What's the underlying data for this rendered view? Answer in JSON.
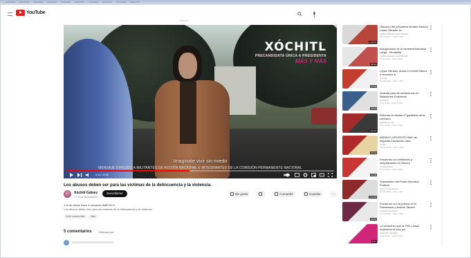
{
  "app": {
    "logo_text": "YouTube",
    "search_placeholder": "Buscar"
  },
  "video": {
    "brand_name": "XÓCHITL",
    "brand_sub": "PRECANDIDATA ÚNICA A PRESIDENTA",
    "brand_slogan": "MÁS Y MÁS",
    "caption": "Imagínate vivir sin miedo",
    "disclaimer": "MENSAJE DIRIGIDO A MILITANTES DE ACCIÓN NACIONAL E INTEGRANTES DE LA COMISIÓN PERMANENTE NACIONAL",
    "timecode": "0:12 / 0:30",
    "progress": 0.46
  },
  "title": "Los abusos deben ser para las víctimas de la delincuencia y la violencia.",
  "channel": {
    "name": "Xóchitl Gálvez",
    "subs": "1.1 M de suscriptores",
    "subscribe_label": "Suscribirme"
  },
  "actions": [
    {
      "label": "Me gusta"
    },
    {
      "label": ""
    },
    {
      "label": "Compartir"
    },
    {
      "label": "Guardar"
    },
    {
      "label": "···"
    }
  ],
  "description": {
    "meta": "1 M de vistas  Hace 4 semanas  #MÉXICO",
    "text": "Los abusos deben ser para las víctimas de la delincuencia y la violencia.",
    "tags": [
      "Ya te convenciste",
      "Más"
    ]
  },
  "comments": {
    "count": "5 comentarios",
    "sort": "Ordenar por"
  },
  "recommendations": [
    {
      "title": "Discurso del presidente Andrés Manuel López Obrador en",
      "channel": "Andrés Manuel López Obrador",
      "meta": "12 mil vistas · hace 2 días",
      "dur": "1:02:14",
      "colors": [
        "#d9d9d9",
        "#b7453a"
      ]
    },
    {
      "title": "Inauguración de la carretera Barranca Larga - Ventanilla",
      "channel": "Andrés Manuel López Obrador",
      "meta": "8 mil vistas · hace 3 días",
      "dur": "58:10",
      "colors": [
        "#e6e6e6",
        "#c0504d"
      ]
    },
    {
      "title": "López Obrador acusa a Xóchitl Gálvez y reconoce a",
      "channel": "Noticias",
      "meta": "20 mil vistas · hace 1 día",
      "dur": "12:34",
      "colors": [
        "#c23d2e",
        "#f0f0f0"
      ]
    },
    {
      "title": "Guardia para de conferencia en Relaciones Exteriores",
      "channel": "Noticieros",
      "meta": "5 mil vistas · hace 6 días",
      "dur": "45:02",
      "colors": [
        "#3b5f8a",
        "#e0e0e0"
      ]
    },
    {
      "title": "Refrenta al oficiale 4º garantiza de la comisión",
      "channel": "Noticias en vivo",
      "meta": "3 mil vistas · hace 4 días",
      "dur": "1:20:05",
      "colors": [
        "#a12a2a",
        "#3a3a3a"
      ]
    },
    {
      "title": "#BRAVO ¡URGENTE! Mitin de segunda inscripción para",
      "channel": "Canal",
      "meta": "15 mil vistas · hace 2 días",
      "dur": "33:40",
      "colors": [
        "#b02a2a",
        "#e8d3a1"
      ]
    },
    {
      "title": "Encuentro con militantes y simpatizantes en México",
      "channel": "Xóchitl Gálvez",
      "meta": "9 mil vistas · hace 5 días",
      "dur": "22:18",
      "colors": [
        "#c93535",
        "#f4f4f4"
      ]
    },
    {
      "title": "Transmisión del Poder Ejecutivo Federal",
      "channel": "Gobierno de México",
      "meta": "30 mil vistas · hace 1 día",
      "dur": "2:10:00",
      "colors": [
        "#8f2a2a",
        "#dddddd"
      ]
    },
    {
      "title": "Encuentro con la prensa en el Sheinbaum y Andrés Tabanil",
      "channel": "Claudia Sheinbaum",
      "meta": "11 mil vistas · hace 3 días",
      "dur": "18:55",
      "colors": [
        "#6e2a45",
        "#e9e9e9"
      ]
    },
    {
      "title": "La verdad es que la TVN ¿Hace realmente el voto por",
      "channel": "XÓCHITL GÁLVEZ",
      "meta": "6 mil vistas · hace 6 días",
      "dur": "9:47",
      "colors": [
        "#ffffff",
        "#d0267a"
      ]
    }
  ]
}
